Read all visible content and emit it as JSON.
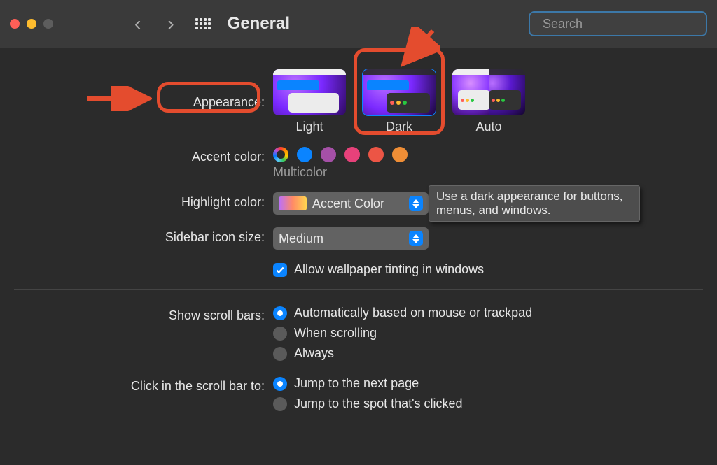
{
  "toolbar": {
    "title": "General",
    "search_placeholder": "Search"
  },
  "appearance": {
    "label": "Appearance:",
    "options": {
      "light": "Light",
      "dark": "Dark",
      "auto": "Auto"
    },
    "selected": "dark",
    "tooltip": "Use a dark appearance for buttons, menus, and windows."
  },
  "accent": {
    "label": "Accent color:",
    "selected_name": "Multicolor",
    "colors": [
      "multicolor",
      "#0a84ff",
      "#a550a7",
      "#e7417a",
      "#ec5545",
      "#ef8e36",
      "#f7ba2f",
      "#78b95b",
      "#8e8e93"
    ]
  },
  "highlight": {
    "label": "Highlight color:",
    "value": "Accent Color"
  },
  "sidebar_icon": {
    "label": "Sidebar icon size:",
    "value": "Medium"
  },
  "tint": {
    "checked": true,
    "label": "Allow wallpaper tinting in windows"
  },
  "scrollbars": {
    "label": "Show scroll bars:",
    "options": [
      "Automatically based on mouse or trackpad",
      "When scrolling",
      "Always"
    ],
    "selected": 0
  },
  "click_scroll": {
    "label": "Click in the scroll bar to:",
    "options": [
      "Jump to the next page",
      "Jump to the spot that's clicked"
    ],
    "selected": 0
  }
}
